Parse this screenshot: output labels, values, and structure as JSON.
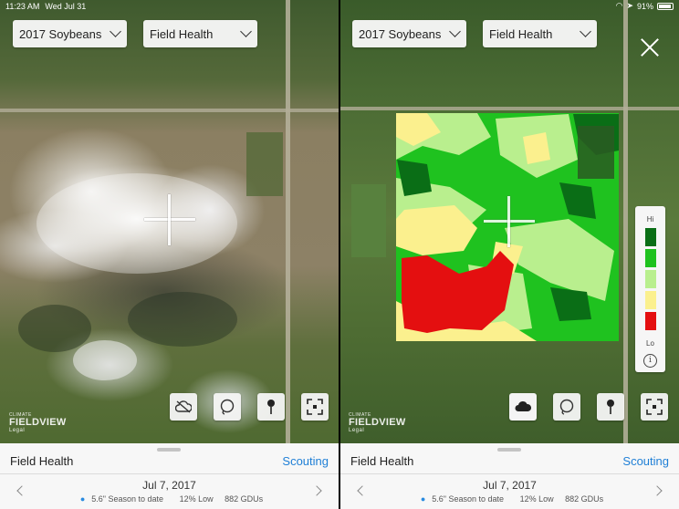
{
  "status": {
    "time": "11:23 AM",
    "date": "Wed Jul 31",
    "battery": "91%"
  },
  "left": {
    "crop_select": "2017 Soybeans",
    "layer_select": "Field Health",
    "brand_small": "CLIMATE",
    "brand_big": "FIELDVIEW",
    "brand_legal": "Legal",
    "panel": {
      "title": "Field Health",
      "link": "Scouting",
      "date": "Jul 7, 2017",
      "precip": "5.6\" Season to date",
      "low": "12% Low",
      "gdu": "882 GDUs"
    }
  },
  "right": {
    "crop_select": "2017 Soybeans",
    "layer_select": "Field Health",
    "brand_small": "CLIMATE",
    "brand_big": "FIELDVIEW",
    "brand_legal": "Legal",
    "legend": {
      "hi": "Hi",
      "lo": "Lo",
      "info": "i",
      "colors": [
        "#0a6e16",
        "#1fc21f",
        "#b9ef8e",
        "#fbf08e",
        "#e40f10"
      ]
    },
    "panel": {
      "title": "Field Health",
      "link": "Scouting",
      "date": "Jul 7, 2017",
      "precip": "5.6\" Season to date",
      "low": "12% Low",
      "gdu": "882 GDUs"
    }
  },
  "icons": [
    "cloud-icon",
    "lasso-icon",
    "pin-icon",
    "focus-icon",
    "close-icon"
  ],
  "accent": "#1f7fd6"
}
